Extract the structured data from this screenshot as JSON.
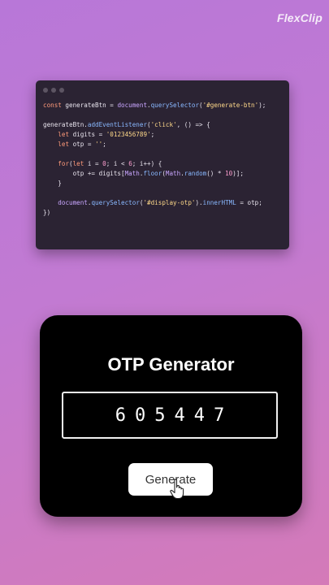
{
  "watermark": {
    "brand": "FlexClip"
  },
  "code_snippet": {
    "lines": [
      "const generateBtn = document.querySelector('#generate-btn');",
      "",
      "generateBtn.addEventListener('click', () => {",
      "    let digits = '0123456789';",
      "    let otp = '';",
      "",
      "    for(let i = 0; i < 6; i++) {",
      "        otp += digits[Math.floor(Math.random() * 10)];",
      "    }",
      "",
      "    document.querySelector('#display-otp').innerHTML = otp;",
      "})"
    ]
  },
  "app": {
    "title": "OTP Generator",
    "otp_display": "605447",
    "generate_label": "Generate"
  },
  "icons": {
    "watermark": "flexclip-logo-icon",
    "cursor": "hand-pointer-icon"
  },
  "colors": {
    "card_background": "#000000",
    "button_background": "#ffffff"
  }
}
